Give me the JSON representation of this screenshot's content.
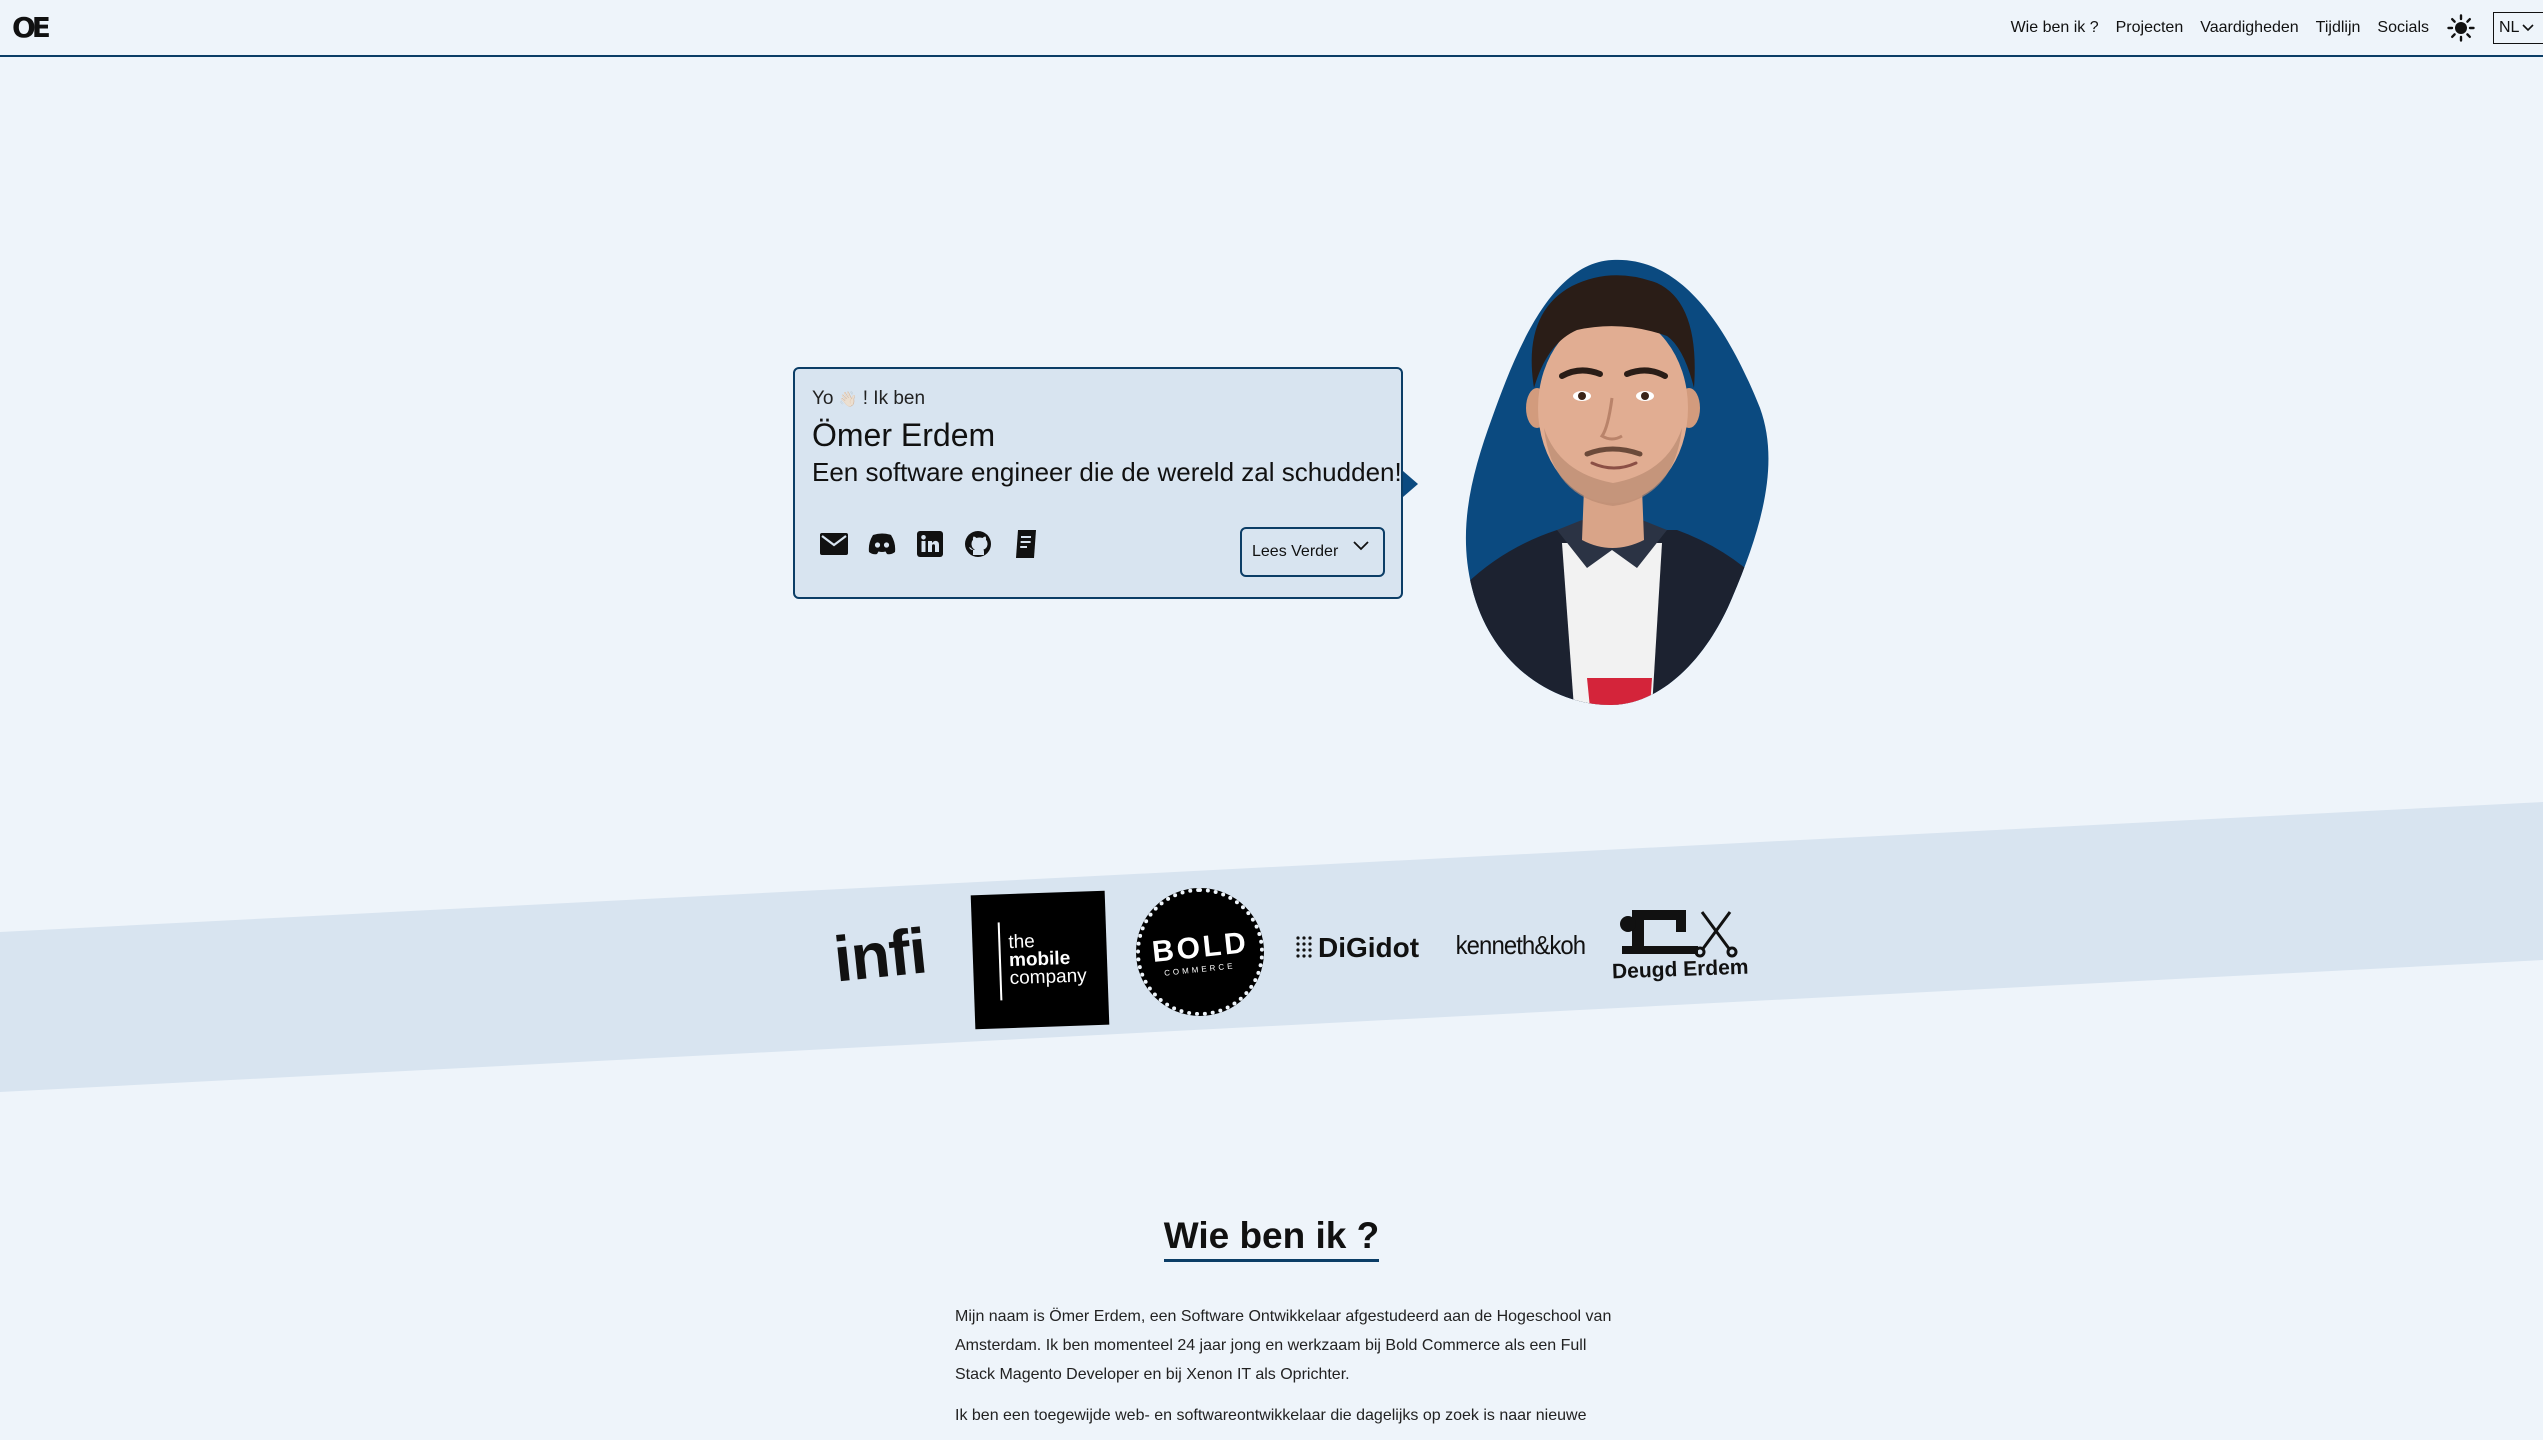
{
  "nav": {
    "logo": "OE",
    "links": [
      "Wie ben ik ?",
      "Projecten",
      "Vaardigheden",
      "Tijdlijn",
      "Socials"
    ],
    "theme_icon": "sun-icon",
    "language": "NL"
  },
  "hero": {
    "greeting_pre": "Yo",
    "greeting_emoji": "👋🏻",
    "greeting_post": "! Ik ben",
    "name": "Ömer Erdem",
    "tagline": "Een software engineer die de wereld zal schudden!",
    "social_icons": [
      "mail-icon",
      "discord-icon",
      "linkedin-icon",
      "github-icon",
      "document-icon"
    ],
    "read_more": "Lees Verder"
  },
  "companies": [
    {
      "name": "infi",
      "text": "infi"
    },
    {
      "name": "the-mobile-company",
      "lines": [
        "the",
        "mobile",
        "company"
      ]
    },
    {
      "name": "bold-commerce",
      "text": "BOLD",
      "sub": "COMMERCE"
    },
    {
      "name": "digidot",
      "text": "DiGidot"
    },
    {
      "name": "kenneth-koh",
      "text": "kenneth&koh"
    },
    {
      "name": "deugd-erdem",
      "text": "Deugd Erdem"
    }
  ],
  "about": {
    "title": "Wie ben ik ?",
    "paragraphs": [
      "Mijn naam is Ömer Erdem, een Software Ontwikkelaar afgestudeerd aan de Hogeschool van Amsterdam. Ik ben momenteel 24 jaar jong en werkzaam bij Bold Commerce als een Full Stack Magento Developer en bij Xenon IT als Oprichter.",
      "Ik ben een toegewijde web- en softwareontwikkelaar die dagelijks op zoek is naar nieuwe"
    ]
  },
  "colors": {
    "background": "#eef4fa",
    "accent": "#0b3d66",
    "card": "#d8e4f0",
    "portrait_blob": "#0b4a80"
  }
}
